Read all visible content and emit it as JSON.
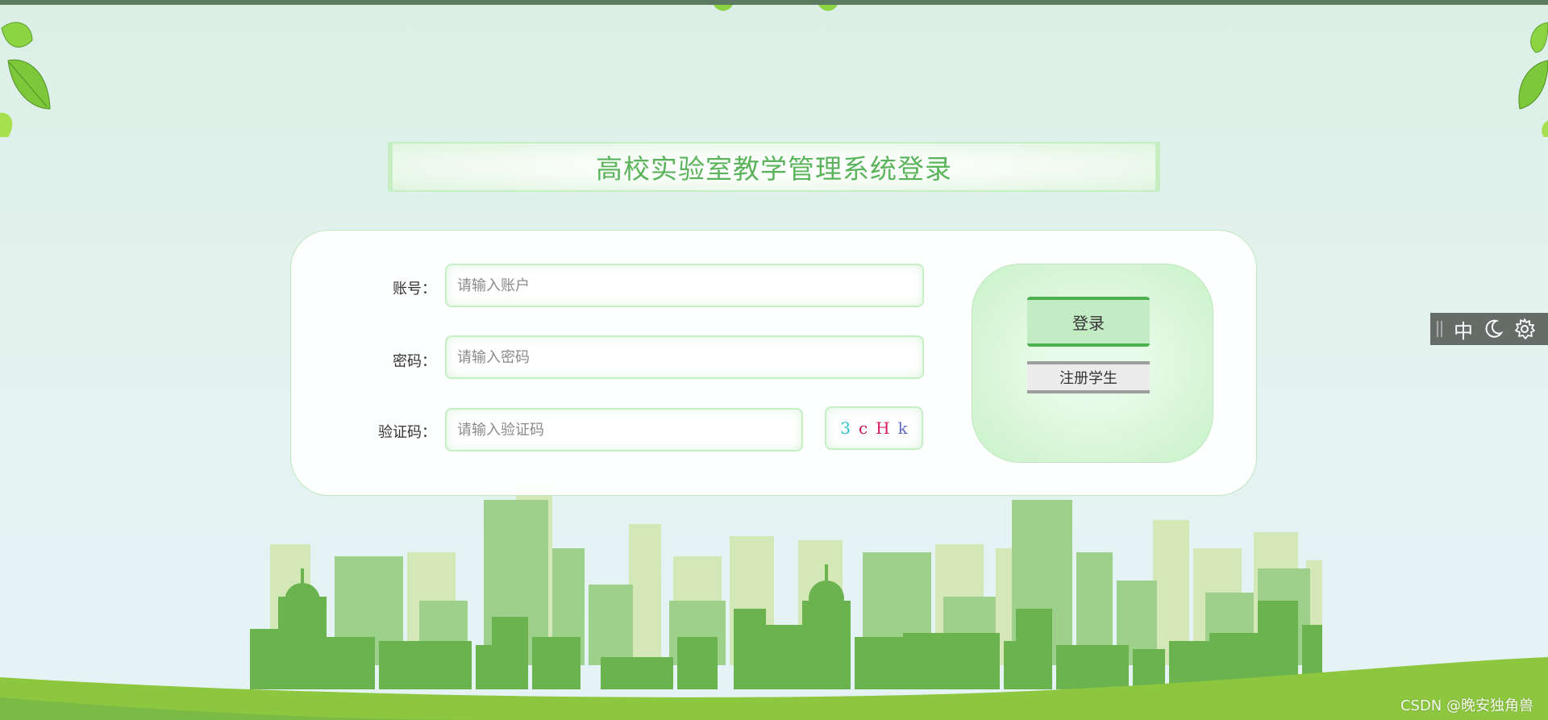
{
  "page": {
    "title": "高校实验室教学管理系统登录"
  },
  "form": {
    "account_label": "账号：",
    "account_placeholder": "请输入账户",
    "password_label": "密码：",
    "password_placeholder": "请输入密码",
    "captcha_label": "验证码：",
    "captcha_placeholder": "请输入验证码",
    "captcha_chars": [
      {
        "ch": "3",
        "color": "#27c3c9"
      },
      {
        "ch": "c",
        "color": "#c2185b"
      },
      {
        "ch": "H",
        "color": "#d81b60"
      },
      {
        "ch": "k",
        "color": "#5c6bc0"
      }
    ]
  },
  "buttons": {
    "login_label": "登录",
    "register_label": "注册学生"
  },
  "ime_toolbar": {
    "language": "中",
    "icons": [
      "moon-icon",
      "gear-icon"
    ]
  },
  "watermark": "CSDN @晚安独角兽",
  "colors": {
    "accent_green": "#4caf50",
    "title_green": "#5bb45b",
    "ground_green": "#8dc63f"
  }
}
